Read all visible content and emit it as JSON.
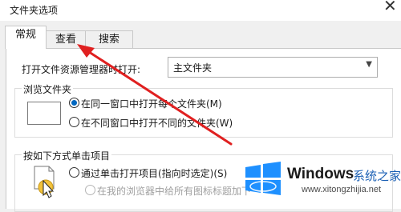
{
  "window": {
    "title": "文件夹选项",
    "close_glyph": "✕"
  },
  "tabs": [
    {
      "label": "常规"
    },
    {
      "label": "查看"
    },
    {
      "label": "搜索"
    }
  ],
  "general": {
    "open_explorer_label": "打开文件资源管理器时打开:",
    "open_explorer_value": "主文件夹",
    "browse_group_title": "浏览文件夹",
    "browse_same_window": "在同一窗口中打开每个文件夹(M)",
    "browse_new_window": "在不同窗口中打开不同的文件夹(W)",
    "click_group_title": "按如下方式单击项目",
    "single_click": "通过单击打开项目(指向时选定)(S)",
    "underline_browser": "在我的浏览器中给所有图标标题加下"
  },
  "watermark": {
    "brand": "Windows",
    "site_cn": "系统之家",
    "url": "www.xitongzhijia.net"
  },
  "colors": {
    "accent": "#0067c0",
    "annotation_arrow": "#e02020"
  }
}
